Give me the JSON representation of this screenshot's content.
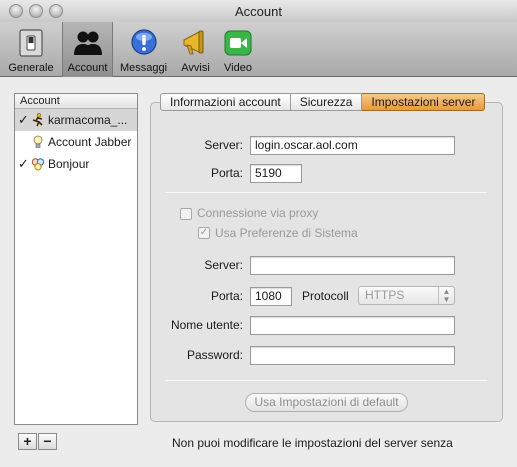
{
  "window": {
    "title": "Account"
  },
  "toolbar": {
    "items": [
      {
        "label": "Generale",
        "icon": "general-switch-icon"
      },
      {
        "label": "Account",
        "icon": "accounts-people-icon"
      },
      {
        "label": "Messaggi",
        "icon": "messages-bubble-icon"
      },
      {
        "label": "Avvisi",
        "icon": "alerts-megaphone-icon"
      },
      {
        "label": "Video",
        "icon": "video-camera-icon"
      }
    ],
    "selected": "Account"
  },
  "sidebar": {
    "header": "Account",
    "items": [
      {
        "label": "karmacoma_...",
        "checked": true,
        "icon": "aim-runner-icon",
        "selected": true
      },
      {
        "label": "Account Jabber",
        "checked": false,
        "icon": "jabber-lightbulb-icon",
        "selected": false
      },
      {
        "label": "Bonjour",
        "checked": true,
        "icon": "bonjour-people-icon",
        "selected": false
      }
    ],
    "add_label": "+",
    "remove_label": "−"
  },
  "tabs": [
    {
      "label": "Informazioni account",
      "active": false
    },
    {
      "label": "Sicurezza",
      "active": false
    },
    {
      "label": "Impostazioni server",
      "active": true
    }
  ],
  "server_settings": {
    "server_label": "Server:",
    "server_value": "login.oscar.aol.com",
    "port_label": "Porta:",
    "port_value": "5190"
  },
  "proxy": {
    "use_proxy_label": "Connessione via proxy",
    "use_proxy_checked": false,
    "use_system_prefs_label": "Usa Preferenze di Sistema",
    "use_system_prefs_checked": true,
    "server_label": "Server:",
    "server_value": "",
    "port_label": "Porta:",
    "port_value": "1080",
    "protocol_label": "Protocoll",
    "protocol_value": "HTTPS",
    "username_label": "Nome utente:",
    "username_value": "",
    "password_label": "Password:",
    "password_value": ""
  },
  "default_button_label": "Usa Impostazioni di default",
  "status_message": "Non puoi modificare le impostazioni del server senza",
  "colors": {
    "active_tab": "#e99a3a",
    "selection": "#d6d6d6"
  }
}
